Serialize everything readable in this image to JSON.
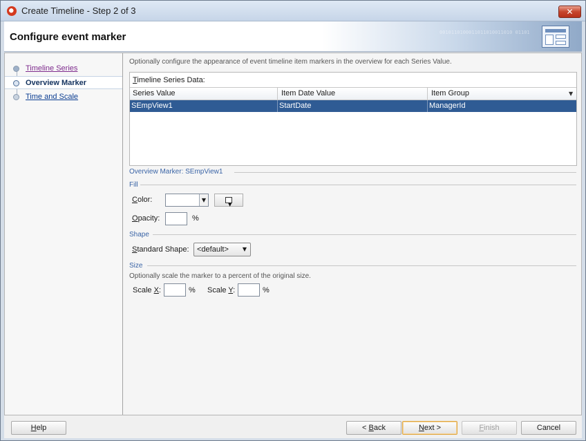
{
  "window": {
    "title": "Create Timeline - Step 2 of 3",
    "close_label": "✕"
  },
  "header": {
    "title": "Configure event marker",
    "decoration_text": "0010110100011011010011010 01101001001101"
  },
  "nav": {
    "items": [
      {
        "label": "Timeline Series",
        "state": "visited"
      },
      {
        "label": "Overview Marker",
        "state": "current"
      },
      {
        "label": "Time and Scale",
        "state": "unvisited"
      }
    ]
  },
  "content": {
    "hint": "Optionally configure the appearance of event timeline item markers in the overview for each Series Value.",
    "table": {
      "caption_mnemonic": "T",
      "caption_rest": "imeline Series Data:",
      "columns": [
        "Series Value",
        "Item Date Value",
        "Item Group"
      ],
      "rows": [
        [
          "SEmpView1",
          "StartDate",
          "ManagerId"
        ]
      ]
    },
    "overview_marker_title": "Overview Marker: SEmpView1",
    "fill": {
      "title": "Fill",
      "color_mnemonic": "C",
      "color_rest": "olor:",
      "color_value": "",
      "opacity_mnemonic": "O",
      "opacity_rest": "pacity:",
      "opacity_value": "",
      "opacity_unit": "%"
    },
    "shape": {
      "title": "Shape",
      "standard_mnemonic": "S",
      "standard_rest": "tandard Shape:",
      "selected": "<default>"
    },
    "size": {
      "title": "Size",
      "hint": "Optionally scale the marker to a percent of the original size.",
      "scale_x_prefix": "Scale ",
      "scale_x_mnemonic": "X",
      "scale_x_value": "",
      "scale_y_prefix": "Scale ",
      "scale_y_mnemonic": "Y",
      "scale_y_value": "",
      "colon": ":",
      "unit": "%"
    }
  },
  "footer": {
    "help_mnemonic": "H",
    "help_rest": "elp",
    "back_prefix": "< ",
    "back_mnemonic": "B",
    "back_rest": "ack",
    "next_mnemonic": "N",
    "next_rest": "ext >",
    "finish_mnemonic": "F",
    "finish_rest": "inish",
    "cancel_label": "Cancel"
  }
}
